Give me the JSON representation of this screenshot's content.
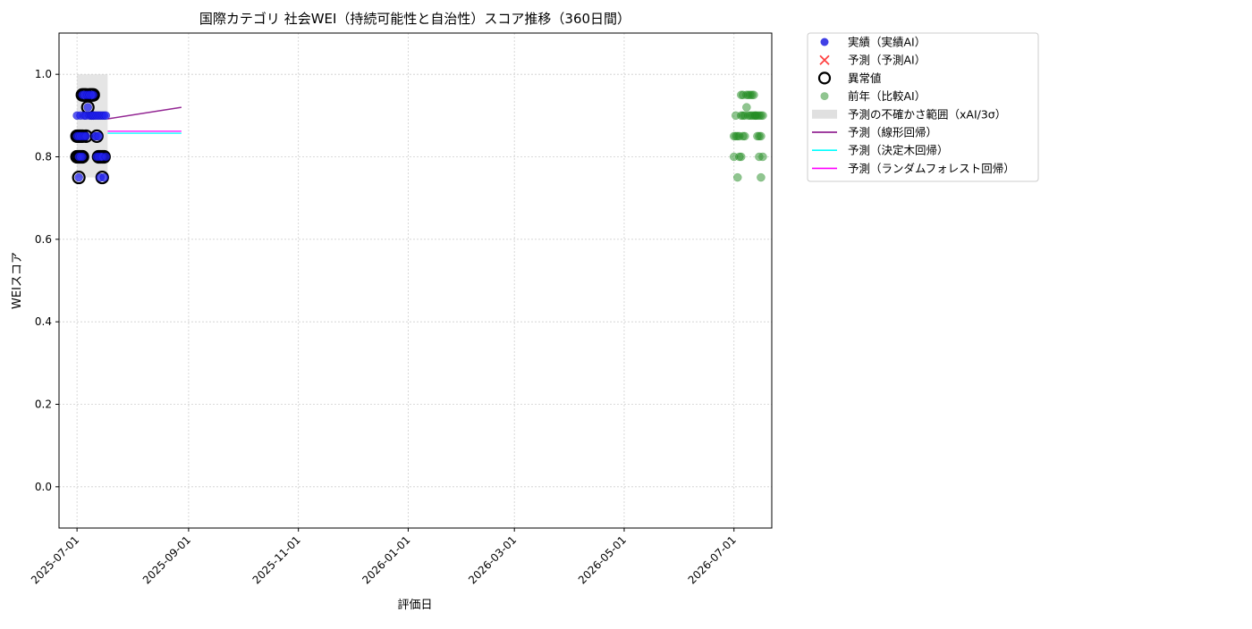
{
  "chart_data": {
    "type": "scatter",
    "title": "国際カテゴリ 社会WEI（持続可能性と自治性）スコア推移（360日間）",
    "xlabel": "評価日",
    "ylabel": "WEIスコア",
    "xlim": [
      "2025-06-21",
      "2026-07-22"
    ],
    "ylim": [
      -0.1,
      1.1
    ],
    "x_ticks": [
      "2025-07-01",
      "2025-09-01",
      "2025-11-01",
      "2026-01-01",
      "2026-03-01",
      "2026-05-01",
      "2026-07-01"
    ],
    "y_ticks": [
      0.0,
      0.2,
      0.4,
      0.6,
      0.8,
      1.0
    ],
    "y_tick_labels": [
      "0.0",
      "0.2",
      "0.4",
      "0.6",
      "0.8",
      "1.0"
    ],
    "grid": true,
    "legend_position": "outside-top-right",
    "legend": [
      {
        "key": "actual",
        "label": "実績（実績AI）",
        "marker": "circle",
        "color": "#0000dd"
      },
      {
        "key": "predicted",
        "label": "予測（予測AI）",
        "marker": "x",
        "color": "#ff2222"
      },
      {
        "key": "anomaly",
        "label": "異常値",
        "marker": "ring",
        "color": "#000000"
      },
      {
        "key": "previous",
        "label": "前年（比較AI）",
        "marker": "circle",
        "color": "#228b22"
      },
      {
        "key": "band",
        "label": "予測の不確かさ範囲（xAI/3σ）",
        "marker": "rect",
        "color": "#cccccc"
      },
      {
        "key": "linear",
        "label": "予測（線形回帰）",
        "marker": "line",
        "color": "#800080"
      },
      {
        "key": "tree",
        "label": "予測（決定木回帰）",
        "marker": "line",
        "color": "#00ffff"
      },
      {
        "key": "forest",
        "label": "予測（ランダムフォレスト回帰）",
        "marker": "line",
        "color": "#ff00ff"
      }
    ],
    "series": {
      "actual": {
        "name": "実績（実績AI）",
        "x": [
          "2025-07-01",
          "2025-07-01",
          "2025-07-02",
          "2025-07-02",
          "2025-07-02",
          "2025-07-03",
          "2025-07-03",
          "2025-07-03",
          "2025-07-04",
          "2025-07-04",
          "2025-07-04",
          "2025-07-05",
          "2025-07-05",
          "2025-07-05",
          "2025-07-06",
          "2025-07-06",
          "2025-07-06",
          "2025-07-07",
          "2025-07-07",
          "2025-07-08",
          "2025-07-08",
          "2025-07-08",
          "2025-07-09",
          "2025-07-09",
          "2025-07-09",
          "2025-07-10",
          "2025-07-10",
          "2025-07-10",
          "2025-07-11",
          "2025-07-11",
          "2025-07-12",
          "2025-07-12",
          "2025-07-12",
          "2025-07-13",
          "2025-07-13",
          "2025-07-13",
          "2025-07-14",
          "2025-07-14",
          "2025-07-14",
          "2025-07-15",
          "2025-07-15",
          "2025-07-16",
          "2025-07-16",
          "2025-07-17",
          "2025-07-17"
        ],
        "y": [
          0.85,
          0.9,
          0.8,
          0.85,
          0.75,
          0.85,
          0.8,
          0.9,
          0.95,
          0.85,
          0.8,
          0.95,
          0.9,
          0.85,
          0.95,
          0.9,
          0.85,
          0.92,
          0.95,
          0.95,
          0.9,
          0.95,
          0.9,
          0.95,
          0.9,
          0.95,
          0.9,
          0.9,
          0.85,
          0.9,
          0.85,
          0.8,
          0.9,
          0.8,
          0.9,
          0.85,
          0.8,
          0.9,
          0.75,
          0.8,
          0.9,
          0.9,
          0.75,
          0.9,
          0.8
        ]
      },
      "anomaly": {
        "name": "異常値",
        "x": [
          "2025-07-01",
          "2025-07-01",
          "2025-07-02",
          "2025-07-02",
          "2025-07-02",
          "2025-07-03",
          "2025-07-03",
          "2025-07-04",
          "2025-07-04",
          "2025-07-04",
          "2025-07-05",
          "2025-07-06",
          "2025-07-06",
          "2025-07-07",
          "2025-07-08",
          "2025-07-09",
          "2025-07-10",
          "2025-07-12",
          "2025-07-13",
          "2025-07-14",
          "2025-07-15",
          "2025-07-15",
          "2025-07-16"
        ],
        "y": [
          0.85,
          0.8,
          0.8,
          0.85,
          0.75,
          0.85,
          0.8,
          0.95,
          0.85,
          0.8,
          0.95,
          0.95,
          0.85,
          0.92,
          0.95,
          0.95,
          0.95,
          0.85,
          0.8,
          0.8,
          0.8,
          0.75,
          0.8
        ]
      },
      "previous": {
        "name": "前年（比較AI）",
        "x": [
          "2026-07-01",
          "2026-07-01",
          "2026-07-02",
          "2026-07-02",
          "2026-07-03",
          "2026-07-03",
          "2026-07-04",
          "2026-07-04",
          "2026-07-05",
          "2026-07-05",
          "2026-07-05",
          "2026-07-06",
          "2026-07-06",
          "2026-07-06",
          "2026-07-07",
          "2026-07-07",
          "2026-07-08",
          "2026-07-08",
          "2026-07-09",
          "2026-07-09",
          "2026-07-10",
          "2026-07-10",
          "2026-07-11",
          "2026-07-11",
          "2026-07-12",
          "2026-07-12",
          "2026-07-13",
          "2026-07-13",
          "2026-07-14",
          "2026-07-14",
          "2026-07-15",
          "2026-07-15",
          "2026-07-15",
          "2026-07-16",
          "2026-07-16",
          "2026-07-16",
          "2026-07-17",
          "2026-07-17"
        ],
        "y": [
          0.85,
          0.8,
          0.9,
          0.85,
          0.85,
          0.75,
          0.8,
          0.85,
          0.9,
          0.95,
          0.8,
          0.9,
          0.85,
          0.95,
          0.9,
          0.85,
          0.95,
          0.92,
          0.9,
          0.95,
          0.9,
          0.95,
          0.9,
          0.95,
          0.9,
          0.95,
          0.9,
          0.9,
          0.9,
          0.85,
          0.8,
          0.9,
          0.85,
          0.9,
          0.85,
          0.75,
          0.8,
          0.9
        ]
      },
      "band": {
        "name": "予測の不確かさ範囲（xAI/3σ）",
        "x_start": "2025-07-01",
        "x_end": "2025-07-18",
        "y_low": 0.75,
        "y_high": 1.0
      },
      "linear": {
        "name": "予測（線形回帰）",
        "x": [
          "2025-07-18",
          "2025-08-28"
        ],
        "y": [
          0.892,
          0.92
        ]
      },
      "tree": {
        "name": "予測（決定木回帰）",
        "x": [
          "2025-07-18",
          "2025-08-28"
        ],
        "y": [
          0.857,
          0.857
        ]
      },
      "forest": {
        "name": "予測（ランダムフォレスト回帰）",
        "x": [
          "2025-07-18",
          "2025-08-28"
        ],
        "y": [
          0.862,
          0.862
        ]
      }
    }
  }
}
